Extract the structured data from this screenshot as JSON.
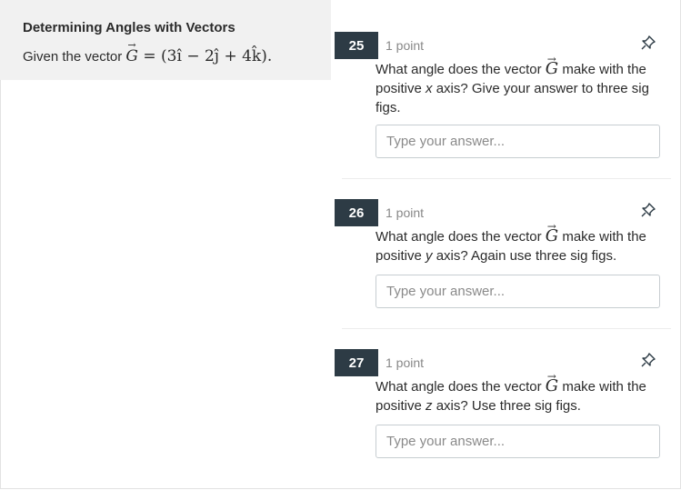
{
  "context": {
    "title": "Determining Angles with Vectors",
    "text_prefix": "Given the vector ",
    "vector_letter": "G",
    "equation": "= (3î − 2ĵ + 4k̂)."
  },
  "questions": [
    {
      "number": "25",
      "points": "1 point",
      "text_before": "What angle does the vector ",
      "vector_letter": "G",
      "text_middle": " make with the positive ",
      "axis": "x",
      "text_after": " axis? Give your answer to three sig figs.",
      "placeholder": "Type your answer..."
    },
    {
      "number": "26",
      "points": "1 point",
      "text_before": "What angle does the vector ",
      "vector_letter": "G",
      "text_middle": " make with the positive ",
      "axis": "y",
      "text_after": " axis? Again use three sig figs.",
      "placeholder": "Type your answer..."
    },
    {
      "number": "27",
      "points": "1 point",
      "text_before": "What angle does the vector ",
      "vector_letter": "G",
      "text_middle": " make with the positive ",
      "axis": "z",
      "text_after": " axis? Use three sig figs.",
      "placeholder": "Type your answer..."
    }
  ],
  "icons": {
    "pin": "pin-icon"
  },
  "colors": {
    "number_badge": "#2d3b45",
    "context_bg": "#f1f1f1",
    "points_text": "#888888"
  }
}
